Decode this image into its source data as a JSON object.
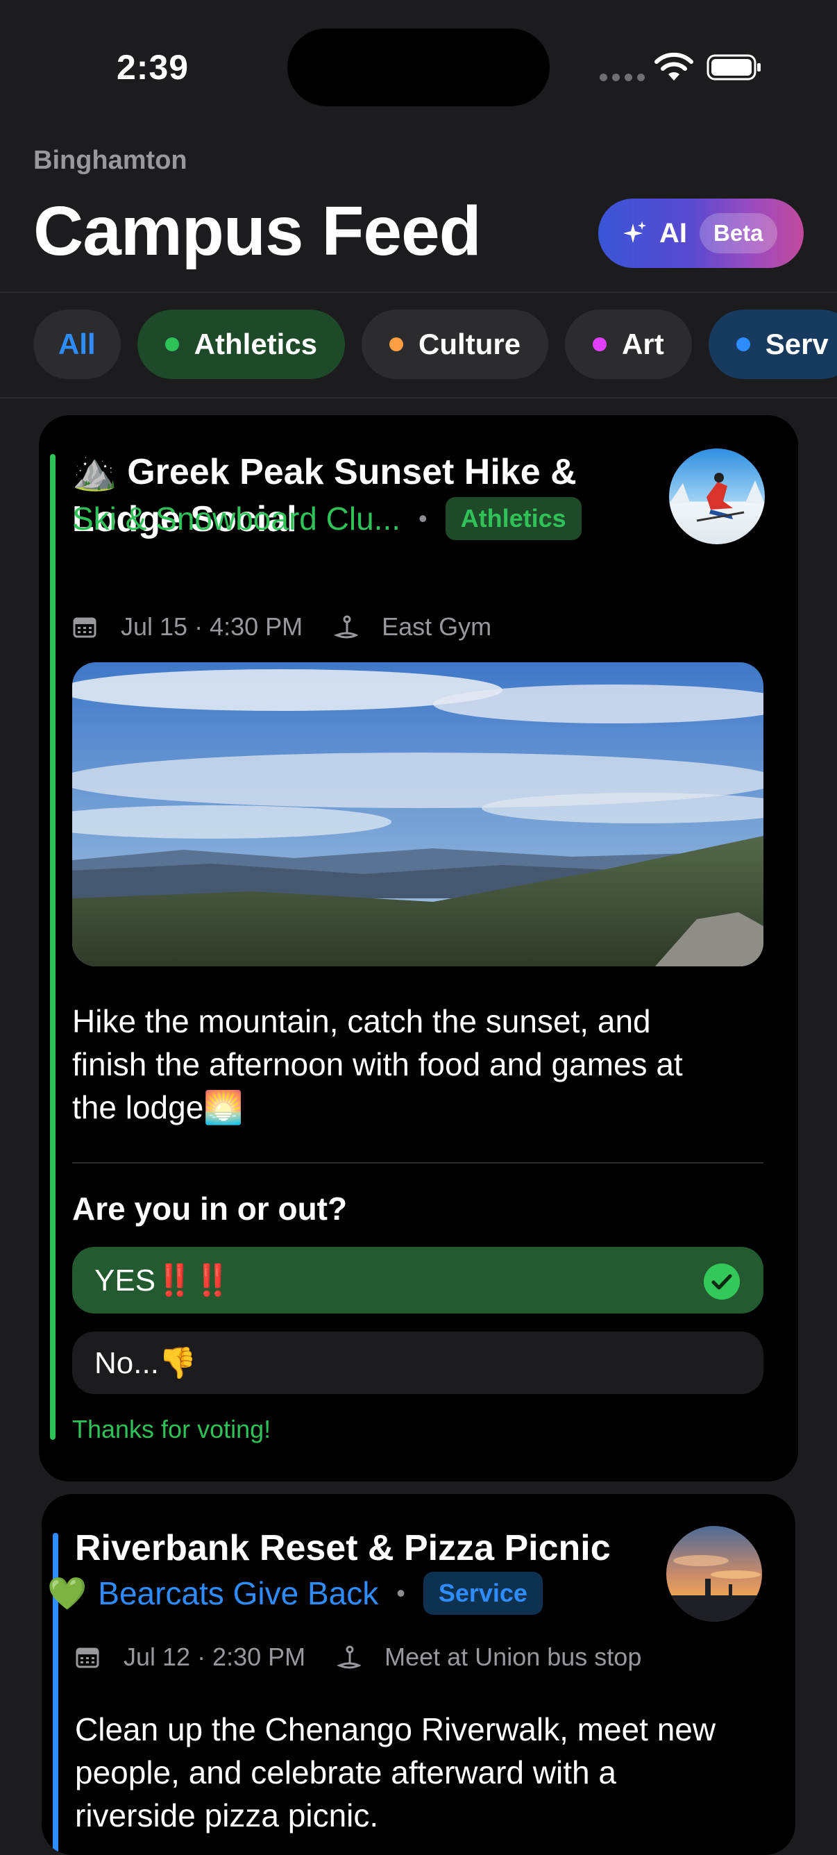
{
  "status_bar": {
    "time": "2:39"
  },
  "header": {
    "campus": "Binghamton",
    "title": "Campus Feed",
    "ai_label": "AI",
    "beta_label": "Beta"
  },
  "filters": [
    {
      "label": "All"
    },
    {
      "label": "Athletics",
      "dot_color": "#30c259"
    },
    {
      "label": "Culture",
      "dot_color": "#ff9f43"
    },
    {
      "label": "Art",
      "dot_color": "#e040fb"
    },
    {
      "label": "Serv",
      "dot_color": "#2f8cff"
    }
  ],
  "posts": [
    {
      "title_line1": "⛰️ Greek Peak Sunset Hike &",
      "title_line2": "Lodge Social",
      "club": "Ski & Snowboard Clu...",
      "separator": "•",
      "category": "Athletics",
      "category_color": "#30c259",
      "date": "Jul 15 · 4:30 PM",
      "location": "East Gym",
      "description_line1": "Hike the mountain, catch the sunset, and",
      "description_line2": "finish the afternoon with food and games at",
      "description_line3": "the lodge🌅",
      "poll": {
        "question": "Are you in or out?",
        "options": [
          {
            "label": "YES‼️‼️",
            "selected": true
          },
          {
            "label": "No...👎",
            "selected": false
          }
        ],
        "status": "Thanks for voting!"
      }
    },
    {
      "title": "Riverbank Reset & Pizza Picnic",
      "club_emoji": "💚",
      "club": "Bearcats Give Back",
      "separator": "•",
      "category": "Service",
      "category_color": "#2f8cff",
      "date": "Jul 12 · 2:30 PM",
      "location": "Meet at Union bus stop",
      "description_line1": "Clean up the Chenango Riverwalk, meet new",
      "description_line2": "people, and celebrate afterward with a",
      "description_line3": "riverside pizza picnic."
    }
  ]
}
